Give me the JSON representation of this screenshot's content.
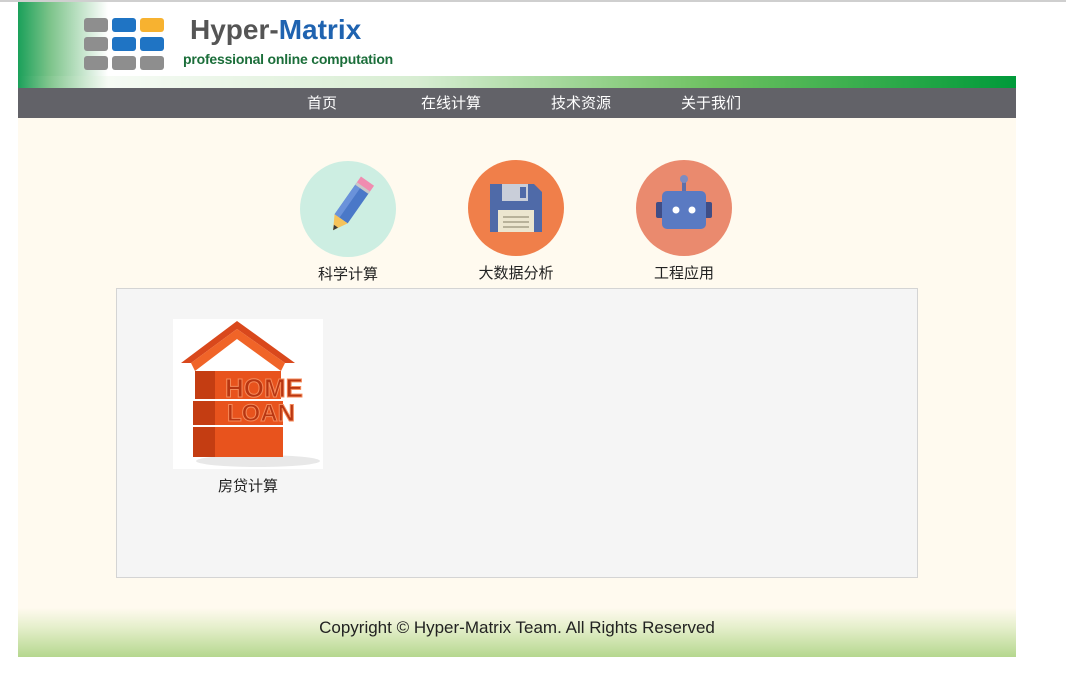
{
  "brand": {
    "name_part1": "Hyper-",
    "name_part2": "Matrix",
    "tagline": "professional online computation"
  },
  "nav": {
    "items": [
      {
        "label": "首页"
      },
      {
        "label": "在线计算"
      },
      {
        "label": "技术资源"
      },
      {
        "label": "关于我们"
      }
    ]
  },
  "categories": [
    {
      "label": "科学计算",
      "icon": "pencil-icon",
      "color": "#cdeee2"
    },
    {
      "label": "大数据分析",
      "icon": "floppy-disk-icon",
      "color": "#f07f4a"
    },
    {
      "label": "工程应用",
      "icon": "robot-icon",
      "color": "#ea8a6e"
    }
  ],
  "content": {
    "items": [
      {
        "label": "房贷计算",
        "image_text_line1": "HOME",
        "image_text_line2": "LOAN"
      }
    ]
  },
  "footer": {
    "copyright": "Copyright © Hyper-Matrix Team. All Rights Reserved"
  },
  "colors": {
    "nav_bg": "#626268",
    "page_bg": "#fffaef",
    "brand_green": "#009a3a",
    "brand_blue": "#1f63b0"
  }
}
